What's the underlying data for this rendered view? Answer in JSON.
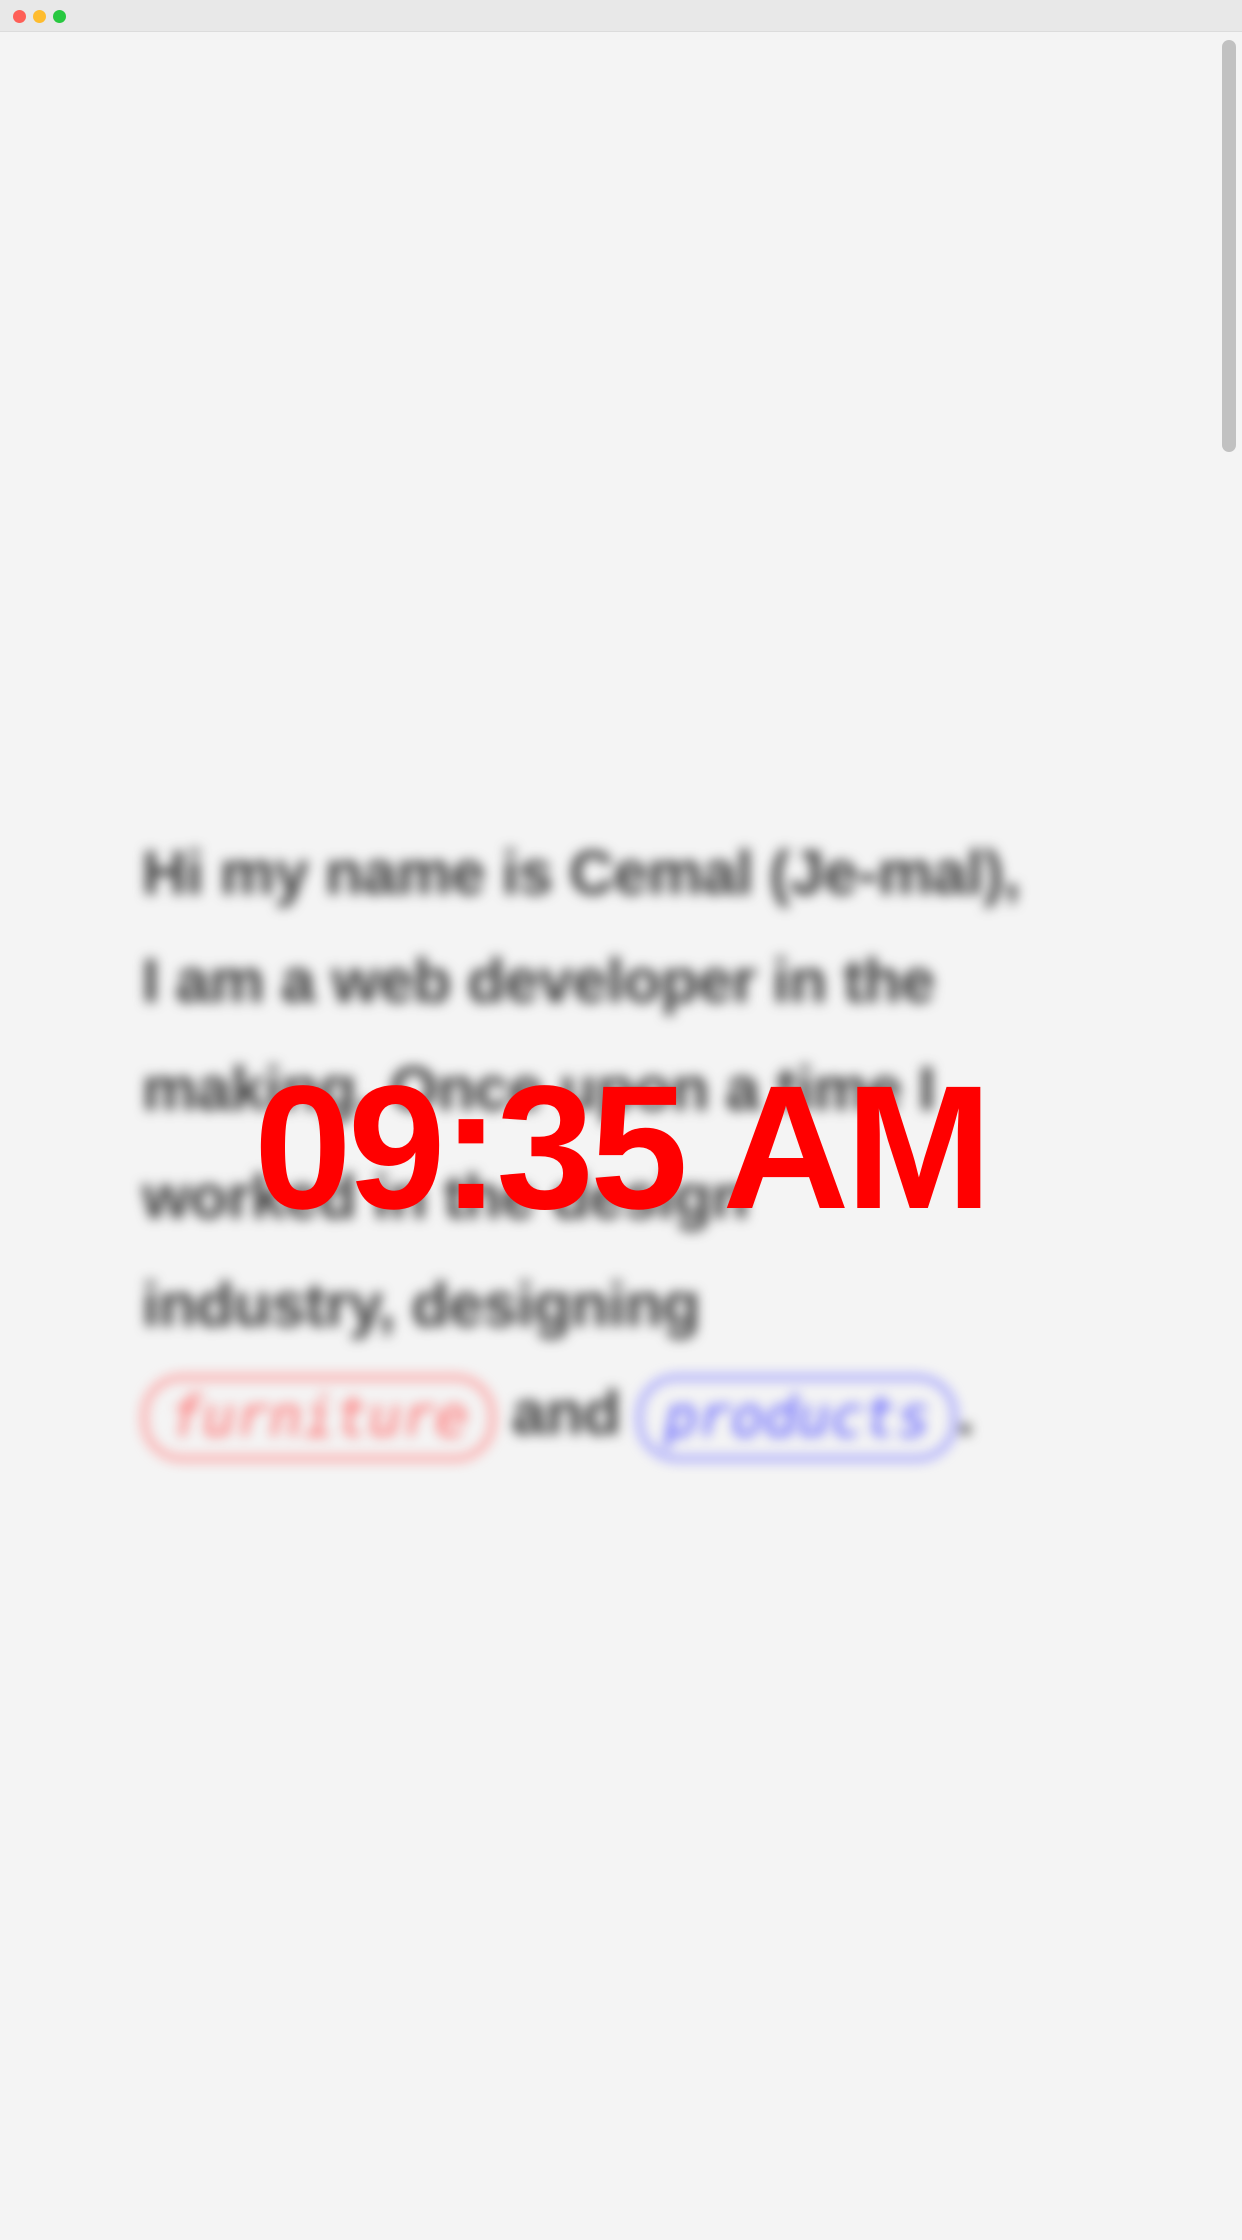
{
  "window": {
    "controls": [
      "close",
      "minimize",
      "zoom"
    ]
  },
  "intro": {
    "line1": "Hi my name is Cemal (Je-mal),",
    "line2": "I am a web developer in the",
    "line3": "making. Once upon a time I",
    "line4": "worked in the design",
    "line5": "industry, designing",
    "pill1": "furniture",
    "connector": "and",
    "pill2": "products",
    "period": "."
  },
  "clock": {
    "time": "09:35 AM"
  },
  "colors": {
    "background": "#f4f4f4",
    "clock": "#ff0000",
    "pill_red": "#ff6b6b",
    "pill_blue": "#5a5aff"
  }
}
